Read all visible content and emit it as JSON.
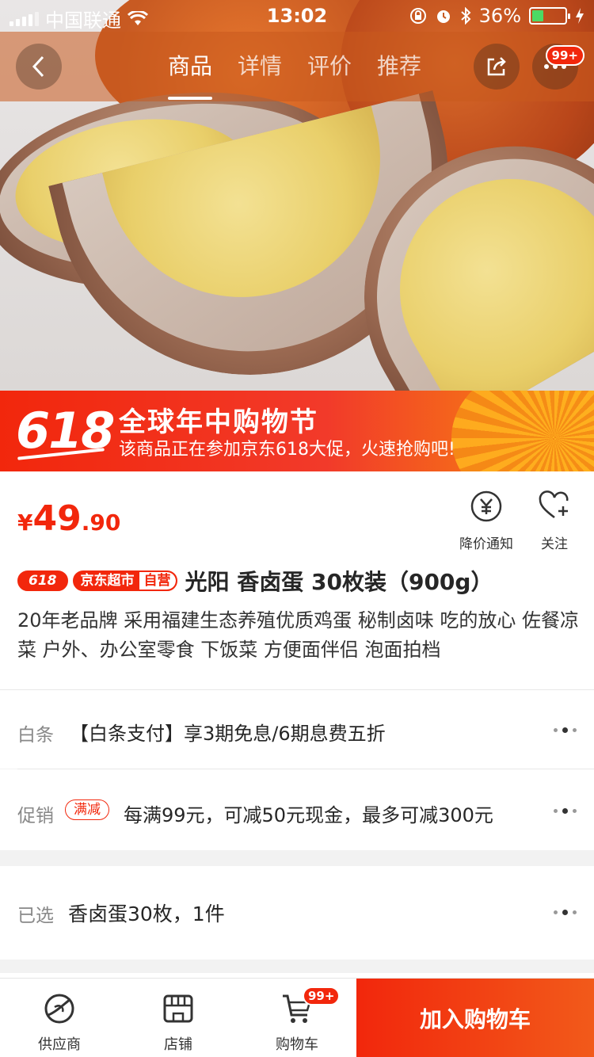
{
  "status_bar": {
    "carrier": "中国联通",
    "time": "13:02",
    "battery": "36%",
    "battery_level": 0.36
  },
  "nav": {
    "tabs": [
      "商品",
      "详情",
      "评价",
      "推荐"
    ],
    "active_tab": 0,
    "more_badge": "99+",
    "icons": [
      "back-icon",
      "share-icon",
      "more-icon"
    ]
  },
  "promo_banner": {
    "badge": "618",
    "title": "全球年中购物节",
    "subtitle": "该商品正在参加京东618大促，火速抢购吧!"
  },
  "product": {
    "price_currency": "¥",
    "price_integer": "49",
    "price_decimal": ".90",
    "price_alert_label": "降价通知",
    "follow_label": "关注",
    "tag_618": "618",
    "tag_store": "京东超市",
    "tag_self": "自营",
    "title": "光阳 香卤蛋 30枚装（900g）",
    "description": "20年老品牌 采用福建生态养殖优质鸡蛋 秘制卤味 吃的放心 佐餐凉菜 户外、办公室零食 下饭菜 方便面伴侣 泡面拍档"
  },
  "baitiao": {
    "label": "白条",
    "text": "【白条支付】享3期免息/6期息费五折"
  },
  "promotion": {
    "label": "促销",
    "tag": "满减",
    "text": "每满99元，可减50元现金，最多可减300元"
  },
  "selected": {
    "label": "已选",
    "text": "香卤蛋30枚，1件"
  },
  "bottom_bar": {
    "supplier_label": "供应商",
    "store_label": "店铺",
    "cart_label": "购物车",
    "cart_badge": "99+",
    "add_to_cart": "加入购物车"
  },
  "colors": {
    "accent": "#f2270c",
    "banner_end": "#f8a020"
  }
}
